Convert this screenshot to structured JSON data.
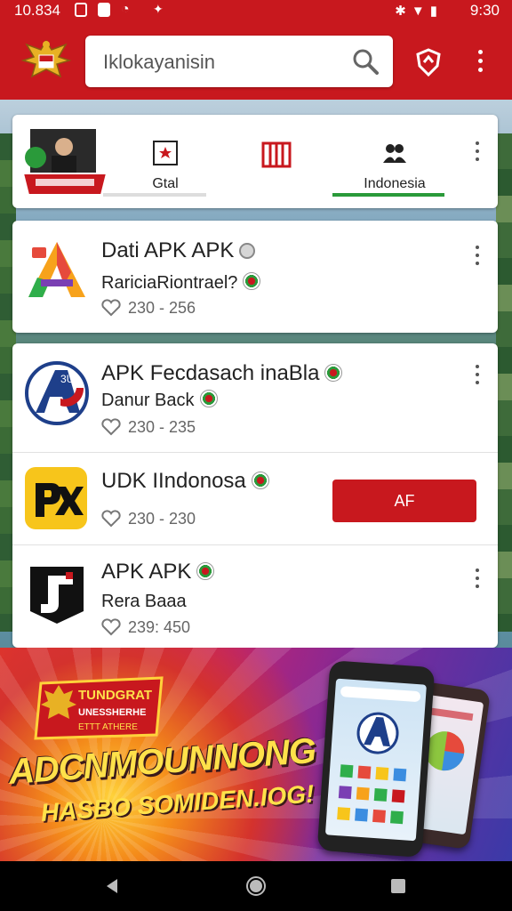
{
  "status_bar": {
    "time": "10.834",
    "right_time": "9:30"
  },
  "search": {
    "value": "Iklokayanisin"
  },
  "categories": [
    {
      "label": "Gtal"
    },
    {
      "label": ""
    },
    {
      "label": "Indonesia"
    }
  ],
  "apps": [
    {
      "title": "Dati APK APK",
      "subtitle": "RariciaRiontrael?",
      "stat": "230 - 256"
    },
    {
      "title": "APK Fecdasach inaBla",
      "subtitle": "Danur Back",
      "stat": "230 - 235"
    },
    {
      "title": "UDK IIndonosa",
      "subtitle": "",
      "stat": "230 - 230",
      "button": "AF"
    },
    {
      "title": "APK APK",
      "subtitle": "Rera Baaa",
      "stat": "239: 450"
    }
  ],
  "banner": {
    "badge_line1": "TUNDGRAT",
    "badge_line2": "UNESSHERHE",
    "badge_line3": "ETTT ATHERE",
    "headline": "ADCNMOUNNONG",
    "subline": "HASBO SOMIDEN.IOG!"
  },
  "colors": {
    "brand_red": "#c8181e",
    "accent_green": "#2a9a3a"
  }
}
